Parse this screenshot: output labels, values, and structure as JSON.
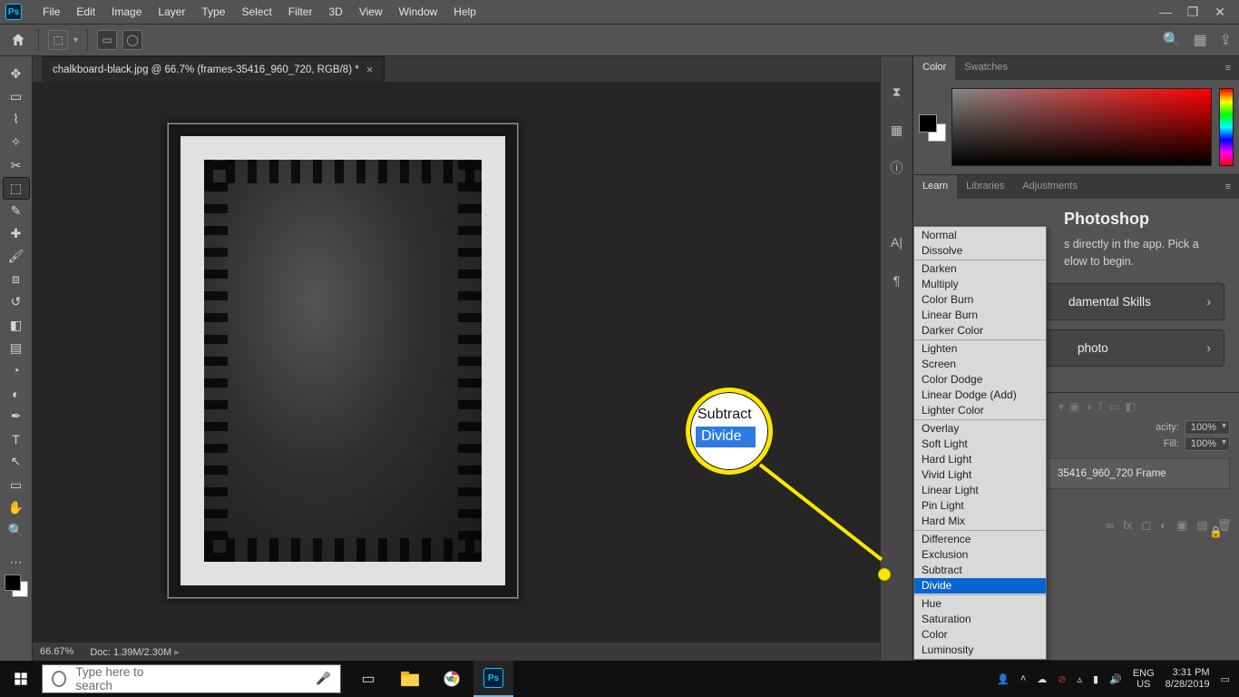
{
  "menubar": {
    "items": [
      "File",
      "Edit",
      "Image",
      "Layer",
      "Type",
      "Select",
      "Filter",
      "3D",
      "View",
      "Window",
      "Help"
    ]
  },
  "window_controls": {
    "minimize": "—",
    "restore": "❐",
    "close": "✕"
  },
  "document": {
    "tab_title": "chalkboard-black.jpg @ 66.7% (frames-35416_960_720, RGB/8) *",
    "zoom": "66.67%",
    "docinfo": "Doc: 1.39M/2.30M"
  },
  "panels": {
    "color_tabs": [
      "Color",
      "Swatches"
    ],
    "learn_tabs": [
      "Learn",
      "Libraries",
      "Adjustments"
    ],
    "learn": {
      "title_fragment": "Photoshop",
      "desc_fragment1": "s directly in the app. Pick a",
      "desc_fragment2": "elow to begin.",
      "btn1": "damental Skills",
      "btn2": "photo"
    },
    "layers": {
      "opacity_label": "acity:",
      "opacity_value": "100%",
      "fill_label": "Fill:",
      "fill_value": "100%",
      "layer_name": "35416_960_720 Frame"
    }
  },
  "blend_modes": {
    "groups": [
      [
        "Normal",
        "Dissolve"
      ],
      [
        "Darken",
        "Multiply",
        "Color Burn",
        "Linear Burn",
        "Darker Color"
      ],
      [
        "Lighten",
        "Screen",
        "Color Dodge",
        "Linear Dodge (Add)",
        "Lighter Color"
      ],
      [
        "Overlay",
        "Soft Light",
        "Hard Light",
        "Vivid Light",
        "Linear Light",
        "Pin Light",
        "Hard Mix"
      ],
      [
        "Difference",
        "Exclusion",
        "Subtract",
        "Divide"
      ],
      [
        "Hue",
        "Saturation",
        "Color",
        "Luminosity"
      ]
    ],
    "selected": "Divide"
  },
  "callout": {
    "line1": "Subtract",
    "line2": "Divide"
  },
  "taskbar": {
    "search_placeholder": "Type here to search",
    "lang": "ENG",
    "kb": "US",
    "time": "3:31 PM",
    "date": "8/28/2019"
  }
}
